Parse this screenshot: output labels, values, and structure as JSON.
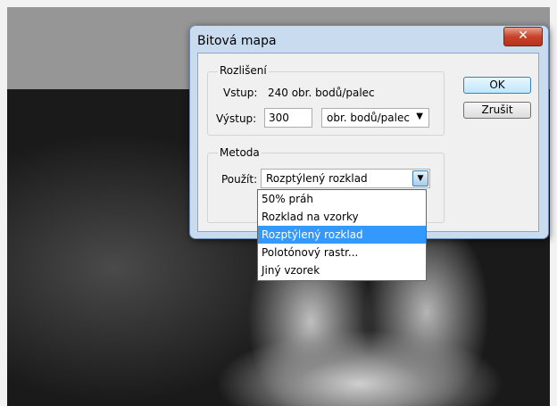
{
  "dialog": {
    "title": "Bitová mapa",
    "close_icon": "close-x-icon",
    "resolution": {
      "legend": "Rozlišení",
      "input_label": "Vstup:",
      "input_value": "240 obr. bodů/palec",
      "output_label": "Výstup:",
      "output_value": "300",
      "unit_selected": "obr. bodů/palec"
    },
    "method": {
      "legend": "Metoda",
      "use_label": "Použít:",
      "use_selected": "Rozptýlený rozklad",
      "options": [
        "50% práh",
        "Rozklad na vzorky",
        "Rozptýlený rozklad",
        "Polotónový rastr...",
        "Jiný vzorek"
      ],
      "highlighted_index": 2
    },
    "buttons": {
      "ok": "OK",
      "cancel": "Zrušit"
    }
  },
  "colors": {
    "selection": "#3399ff",
    "dialog_frame": "#c9dcef",
    "close_button": "#c7432a"
  }
}
